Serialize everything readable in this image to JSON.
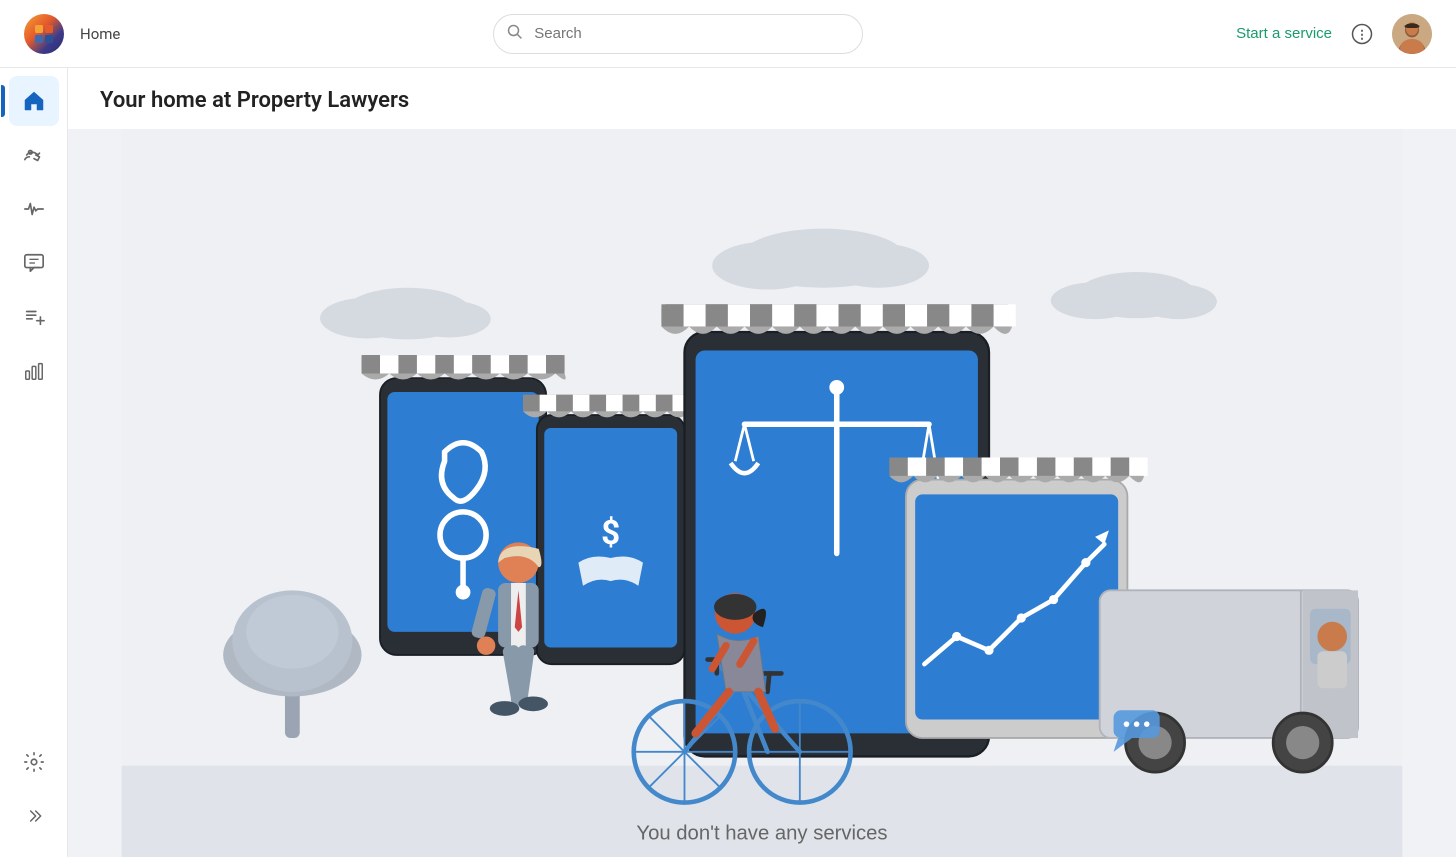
{
  "nav": {
    "home_label": "Home",
    "search_placeholder": "Search",
    "start_service_label": "Start a service",
    "info_icon": "ℹ",
    "logo_alt": "app-logo"
  },
  "sidebar": {
    "items": [
      {
        "id": "home",
        "icon": "🏠",
        "label": "Home",
        "active": true
      },
      {
        "id": "handshake",
        "icon": "🤝",
        "label": "Services",
        "active": false
      },
      {
        "id": "activity",
        "icon": "📈",
        "label": "Activity",
        "active": false
      },
      {
        "id": "messages",
        "icon": "💬",
        "label": "Messages",
        "active": false
      },
      {
        "id": "add-list",
        "icon": "📋",
        "label": "Add List",
        "active": false
      },
      {
        "id": "analytics",
        "icon": "📊",
        "label": "Analytics",
        "active": false
      }
    ],
    "bottom": [
      {
        "id": "settings",
        "icon": "⚙️",
        "label": "Settings"
      },
      {
        "id": "expand",
        "icon": "»",
        "label": "Expand"
      }
    ]
  },
  "page": {
    "title": "Your home at Property Lawyers",
    "subtitle": "You don't have any services"
  },
  "illustration": {
    "background_color": "#f0f2f5",
    "accent_blue": "#2d7dd2"
  }
}
